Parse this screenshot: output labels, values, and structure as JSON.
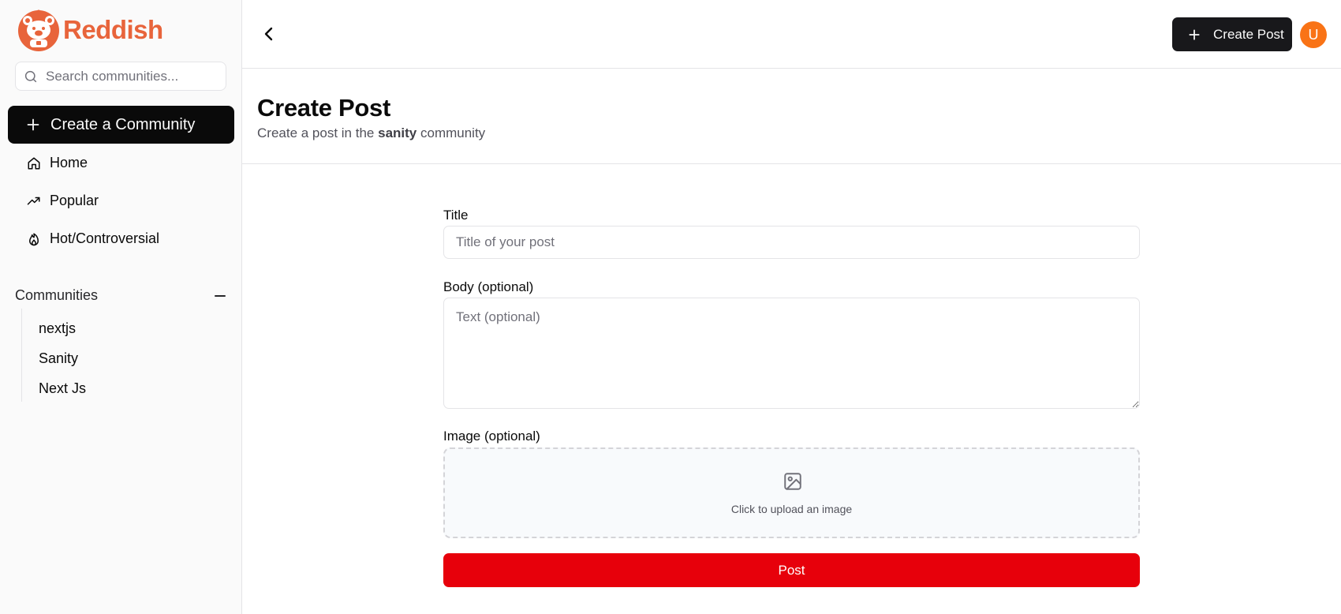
{
  "brand": {
    "name": "Reddish",
    "color": "#e8643b"
  },
  "sidebar": {
    "search_placeholder": "Search communities...",
    "create_community_label": "Create a Community",
    "nav": [
      {
        "label": "Home",
        "icon": "home-icon"
      },
      {
        "label": "Popular",
        "icon": "trending-up-icon"
      },
      {
        "label": "Hot/Controversial",
        "icon": "flame-icon"
      }
    ],
    "communities_header": "Communities",
    "communities": [
      "nextjs",
      "Sanity",
      "Next Js"
    ]
  },
  "topbar": {
    "create_post_label": "Create Post",
    "avatar_initial": "U"
  },
  "page": {
    "title": "Create Post",
    "subtitle_prefix": "Create a post in the",
    "community_name": "sanity",
    "subtitle_suffix": "community"
  },
  "form": {
    "title_label": "Title",
    "title_placeholder": "Title of your post",
    "body_label": "Body (optional)",
    "body_placeholder": "Text (optional)",
    "image_label": "Image (optional)",
    "upload_text": "Click to upload an image",
    "submit_label": "Post"
  },
  "colors": {
    "accent": "#e7000b",
    "primary_button": "#0a0a0a",
    "avatar": "#f97316"
  }
}
